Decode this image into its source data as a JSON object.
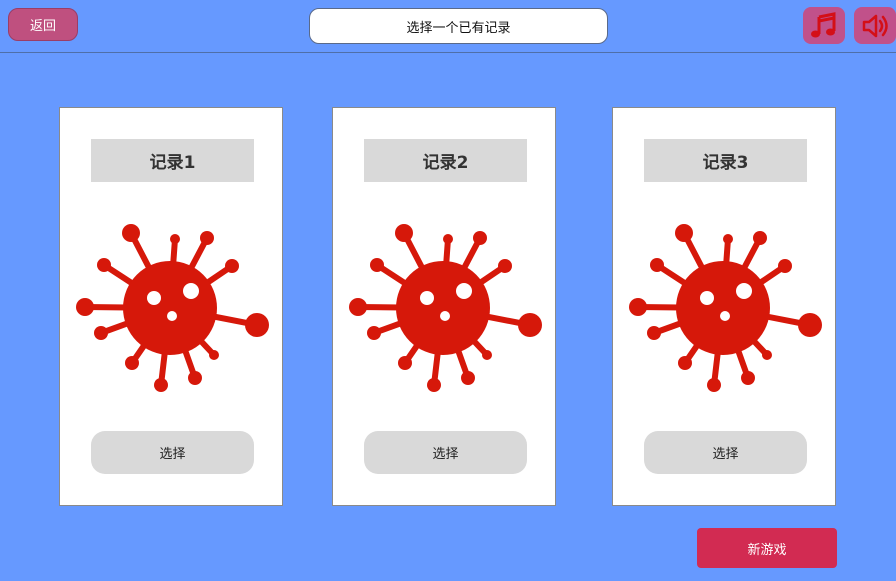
{
  "header": {
    "back_label": "返回",
    "title": "选择一个已有记录",
    "music_icon": "music-note-icon",
    "sound_icon": "speaker-icon"
  },
  "records": [
    {
      "label": "记录1",
      "select_label": "选择",
      "icon": "virus-icon"
    },
    {
      "label": "记录2",
      "select_label": "选择",
      "icon": "virus-icon"
    },
    {
      "label": "记录3",
      "select_label": "选择",
      "icon": "virus-icon"
    }
  ],
  "footer": {
    "new_game_label": "新游戏"
  },
  "colors": {
    "background": "#6699ff",
    "virus": "#d6180a",
    "new_game": "#d22b52",
    "back_button": "#bf507f"
  }
}
